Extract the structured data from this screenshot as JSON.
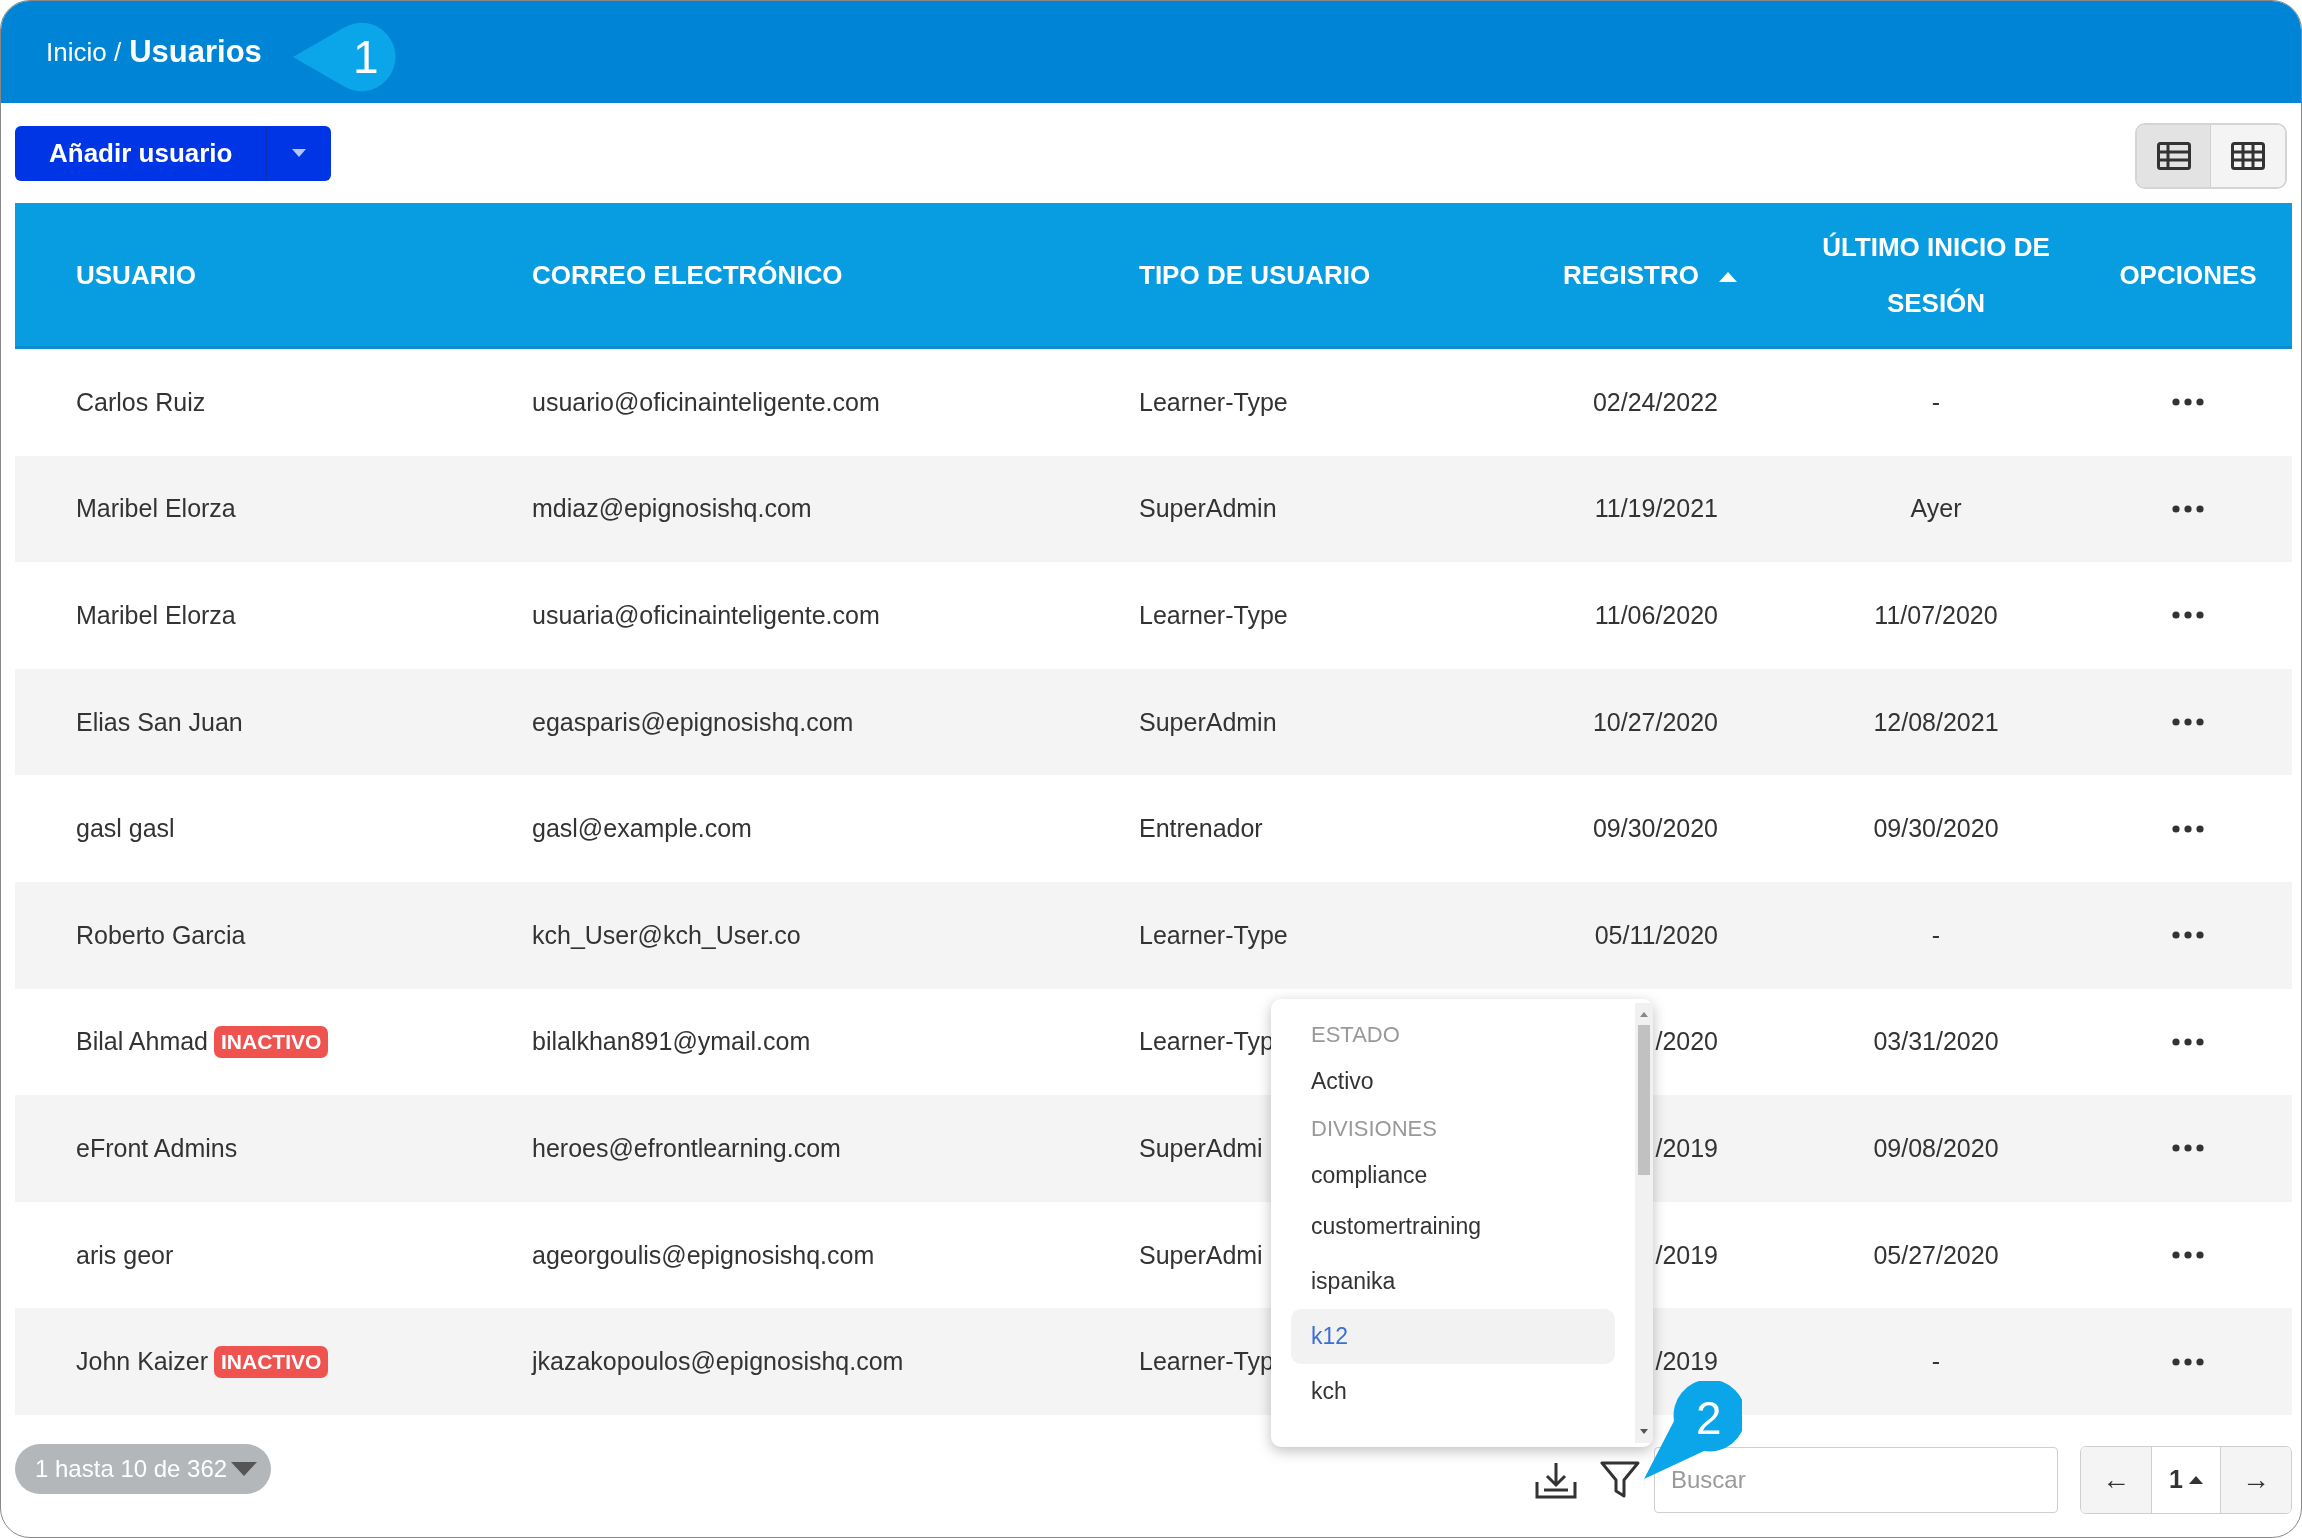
{
  "breadcrumb": {
    "parent": "Inicio /",
    "current": "Usuarios"
  },
  "callouts": [
    {
      "label": "1",
      "kind": "left"
    },
    {
      "label": "2",
      "kind": "down"
    }
  ],
  "toolbar": {
    "add_button": "Añadir usuario",
    "views": [
      {
        "kind": "list",
        "selected": true
      },
      {
        "kind": "grid",
        "selected": false
      }
    ]
  },
  "table": {
    "columns": [
      {
        "label": "USUARIO",
        "sorted": false
      },
      {
        "label": "CORREO ELECTRÓNICO",
        "sorted": false
      },
      {
        "label": "TIPO DE USUARIO",
        "sorted": false
      },
      {
        "label": "REGISTRO",
        "sorted": true
      },
      {
        "label": "ÚLTIMO INICIO DE SESIÓN",
        "sorted": false
      },
      {
        "label": "OPCIONES",
        "sorted": false
      }
    ],
    "rows": [
      {
        "user": "Carlos Ruiz",
        "email": "usuario@oficinainteligente.com",
        "type": "Learner-Type",
        "registered": "02/24/2022",
        "last_login": "-"
      },
      {
        "user": "Maribel Elorza",
        "email": "mdiaz@epignosishq.com",
        "type": "SuperAdmin",
        "registered": "11/19/2021",
        "last_login": "Ayer"
      },
      {
        "user": "Maribel Elorza",
        "email": "usuaria@oficinainteligente.com",
        "type": "Learner-Type",
        "registered": "11/06/2020",
        "last_login": "11/07/2020"
      },
      {
        "user": "Elias San Juan",
        "email": "egasparis@epignosishq.com",
        "type": "SuperAdmin",
        "registered": "10/27/2020",
        "last_login": "12/08/2021"
      },
      {
        "user": "gasl gasl",
        "email": "gasl@example.com",
        "type": "Entrenador",
        "registered": "09/30/2020",
        "last_login": "09/30/2020"
      },
      {
        "user": "Roberto Garcia",
        "email": "kch_User@kch_User.co",
        "type": "Learner-Type",
        "registered": "05/11/2020",
        "last_login": "-"
      },
      {
        "user": "Bilal Ahmad",
        "badge": "INACTIVO",
        "email": "bilalkhan891@ymail.com",
        "type": "Learner-Typ",
        "registered": "/2020",
        "last_login": "03/31/2020"
      },
      {
        "user": "eFront Admins",
        "email": "heroes@efrontlearning.com",
        "type": "SuperAdmi",
        "registered": "/2019",
        "last_login": "09/08/2020"
      },
      {
        "user": "aris geor",
        "email": "ageorgoulis@epignosishq.com",
        "type": "SuperAdmi",
        "registered": "/2019",
        "last_login": "05/27/2020"
      },
      {
        "user": "John Kaizer",
        "badge": "INACTIVO",
        "email": "jkazakopoulos@epignosishq.com",
        "type": "Learner-Typ",
        "registered": "/2019",
        "last_login": "-"
      }
    ]
  },
  "filter_menu": {
    "groups": [
      {
        "heading": "ESTADO",
        "items": [
          {
            "label": "Activo",
            "selected": false
          }
        ]
      },
      {
        "heading": "DIVISIONES",
        "items": [
          {
            "label": "compliance",
            "selected": false
          },
          {
            "label": "customertraining",
            "selected": false
          },
          {
            "label": "ispanika",
            "selected": false
          },
          {
            "label": "k12",
            "selected": true
          },
          {
            "label": "kch",
            "selected": false
          }
        ]
      }
    ]
  },
  "footer": {
    "range": "1 hasta 10 de 362",
    "search": {
      "placeholder": "Buscar"
    },
    "pager": {
      "prev": "←",
      "page": "1",
      "next": "→"
    }
  }
}
